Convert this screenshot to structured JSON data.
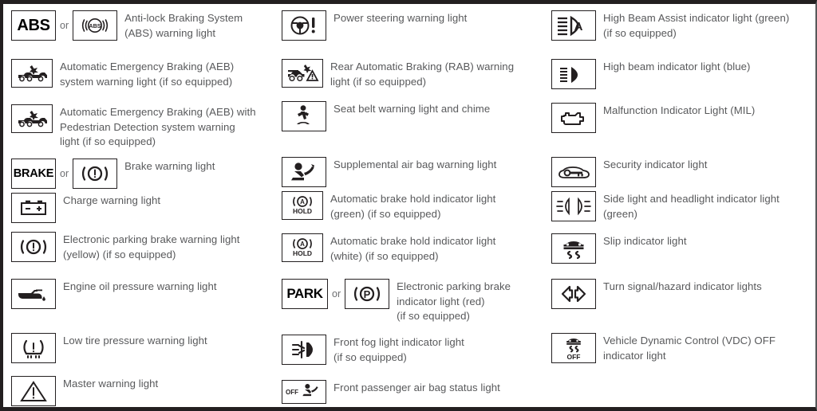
{
  "document": {
    "title": "Vehicle warning and indicator lights legend",
    "text_color": "#58595b",
    "icon_color": "#231f20",
    "or_label": "or"
  },
  "columns": [
    {
      "name": "column-1",
      "rows": [
        {
          "id": "abs",
          "icon": "abs-text-symbol",
          "icon_text": "ABS",
          "alt_icon": "abs-circle-symbol",
          "connector": "or",
          "label": "Anti-lock Braking System\n(ABS) warning light"
        },
        {
          "id": "aeb",
          "icon": "aeb-collision-symbol",
          "label": "Automatic Emergency Braking (AEB)\nsystem warning light (if so equipped)"
        },
        {
          "id": "aeb-pedestrian",
          "icon": "aeb-pedestrian-symbol",
          "label": "Automatic Emergency Braking (AEB) with\nPedestrian Detection system warning\nlight (if so equipped)"
        },
        {
          "id": "brake",
          "icon": "brake-text-symbol",
          "icon_text": "BRAKE",
          "alt_icon": "brake-circle-symbol",
          "connector": "or",
          "label": "Brake warning light"
        },
        {
          "id": "charge",
          "icon": "battery-symbol",
          "label": "Charge warning light"
        },
        {
          "id": "epb-warning",
          "icon": "parking-brake-circle-symbol",
          "label": "Electronic parking brake warning light\n(yellow) (if so equipped)"
        },
        {
          "id": "engine-oil",
          "icon": "oil-can-symbol",
          "label": "Engine oil pressure warning light"
        },
        {
          "id": "tire-pressure",
          "icon": "tire-pressure-symbol",
          "label": "Low tire pressure warning light"
        },
        {
          "id": "master-warning",
          "icon": "warning-triangle-symbol",
          "label": "Master warning light"
        }
      ]
    },
    {
      "name": "column-2",
      "rows": [
        {
          "id": "power-steering",
          "icon": "steering-wheel-symbol",
          "label": "Power steering warning light"
        },
        {
          "id": "rab",
          "icon": "rear-auto-brake-symbol",
          "label": "Rear Automatic Braking (RAB) warning\nlight (if so equipped)"
        },
        {
          "id": "seat-belt",
          "icon": "seat-belt-symbol",
          "label": "Seat belt warning light and chime"
        },
        {
          "id": "air-bag",
          "icon": "air-bag-symbol",
          "label": "Supplemental air bag warning light"
        },
        {
          "id": "brake-hold-green",
          "icon": "auto-hold-symbol",
          "icon_text": "HOLD",
          "label": "Automatic brake hold indicator light\n(green) (if so equipped)"
        },
        {
          "id": "brake-hold-white",
          "icon": "auto-hold-symbol",
          "icon_text": "HOLD",
          "label": "Automatic brake hold indicator light\n(white) (if so equipped)"
        },
        {
          "id": "epb-indicator",
          "icon": "park-text-symbol",
          "icon_text": "PARK",
          "alt_icon": "park-p-circle-symbol",
          "connector": "or",
          "label": "Electronic parking brake\nindicator light (red)\n(if so equipped)"
        },
        {
          "id": "front-fog",
          "icon": "front-fog-lamp-symbol",
          "label": "Front fog light indicator light\n(if so equipped)"
        },
        {
          "id": "passenger-air-bag",
          "icon": "passenger-air-bag-off-symbol",
          "icon_text": "OFF",
          "label": "Front passenger air bag status light"
        }
      ]
    },
    {
      "name": "column-3",
      "rows": [
        {
          "id": "high-beam-assist",
          "icon": "high-beam-assist-symbol",
          "icon_text": "A",
          "label": "High Beam Assist indicator light (green)\n(if so equipped)"
        },
        {
          "id": "high-beam",
          "icon": "high-beam-symbol",
          "label": "High beam indicator light (blue)"
        },
        {
          "id": "mil",
          "icon": "engine-symbol",
          "label": "Malfunction Indicator Light (MIL)"
        },
        {
          "id": "security",
          "icon": "security-car-key-symbol",
          "label": "Security indicator light"
        },
        {
          "id": "side-headlight",
          "icon": "side-headlight-symbol",
          "label": "Side light and headlight indicator light\n(green)"
        },
        {
          "id": "slip",
          "icon": "slip-car-symbol",
          "label": "Slip indicator light"
        },
        {
          "id": "turn-signal",
          "icon": "turn-signal-arrows-symbol",
          "label": "Turn signal/hazard indicator lights"
        },
        {
          "id": "vdc-off",
          "icon": "vdc-off-symbol",
          "icon_text": "OFF",
          "label": "Vehicle Dynamic Control (VDC) OFF\nindicator light"
        }
      ]
    }
  ]
}
